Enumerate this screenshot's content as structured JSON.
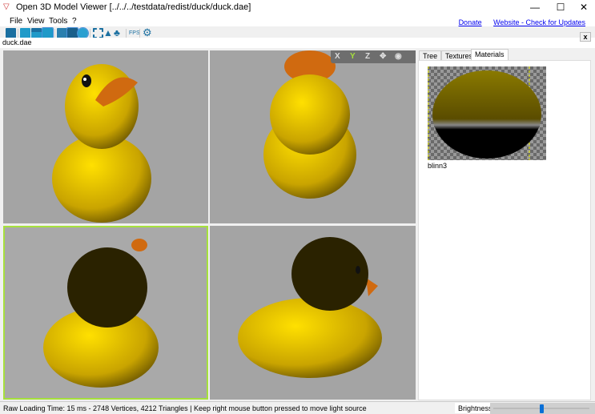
{
  "window": {
    "title": "Open 3D Model Viewer  [../../../testdata/redist/duck/duck.dae]",
    "minimize": "—",
    "maximize": "☐",
    "close": "✕"
  },
  "menu": [
    "File",
    "View",
    "Tools",
    "?"
  ],
  "links": {
    "donate": "Donate",
    "website": "Website - Check for Updates"
  },
  "toolbar": {
    "fps": "FPS"
  },
  "document_tab": "duck.dae",
  "close_tab": "x",
  "viewport_tools": {
    "x": "X",
    "y": "Y",
    "z": "Z"
  },
  "panel": {
    "tabs": [
      "Tree",
      "Textures",
      "Materials"
    ],
    "active_tab": "Materials",
    "materials": [
      {
        "name": "blinn3"
      }
    ]
  },
  "status": {
    "text": "Raw Loading Time: 15 ms - 2748 Vertices, 4212 Triangles  | Keep right mouse button pressed to move light source",
    "brightness_label": "Brightness",
    "brightness": 50
  },
  "colors": {
    "active_viewport": "#a6e03c",
    "accent": "#0a6fd6",
    "duck": "#e8c800"
  }
}
